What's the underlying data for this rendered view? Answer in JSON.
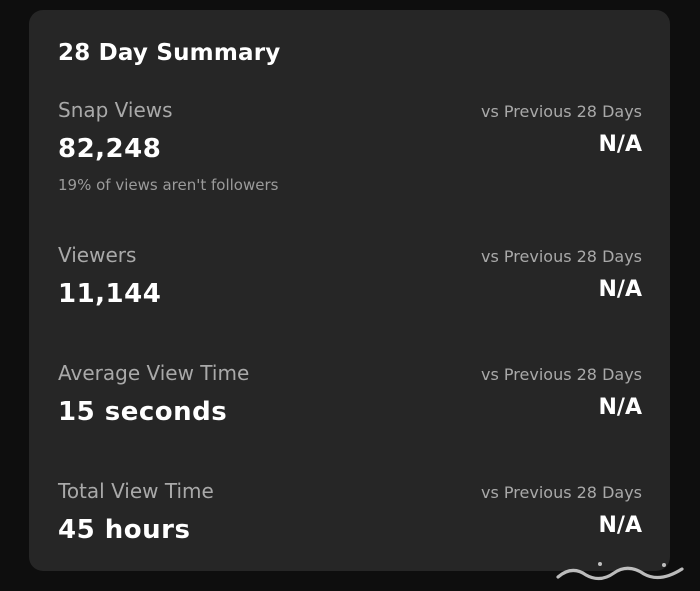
{
  "card": {
    "title": "28 Day Summary"
  },
  "metrics": [
    {
      "label": "Snap Views",
      "value": "82,248",
      "compare_label": "vs Previous 28 Days",
      "compare_value": "N/A",
      "note": "19% of views aren't followers"
    },
    {
      "label": "Viewers",
      "value": "11,144",
      "compare_label": "vs Previous 28 Days",
      "compare_value": "N/A"
    },
    {
      "label": "Average View Time",
      "value": "15 seconds",
      "compare_label": "vs Previous 28 Days",
      "compare_value": "N/A"
    },
    {
      "label": "Total View Time",
      "value": "45 hours",
      "compare_label": "vs Previous 28 Days",
      "compare_value": "N/A"
    }
  ],
  "colors": {
    "background": "#0e0e0e",
    "card": "#262626",
    "primary_text": "#ffffff",
    "secondary_text": "#a9a9a9"
  },
  "watermark": {
    "text": "حراج",
    "icon": "haraj-logo-watermark"
  }
}
